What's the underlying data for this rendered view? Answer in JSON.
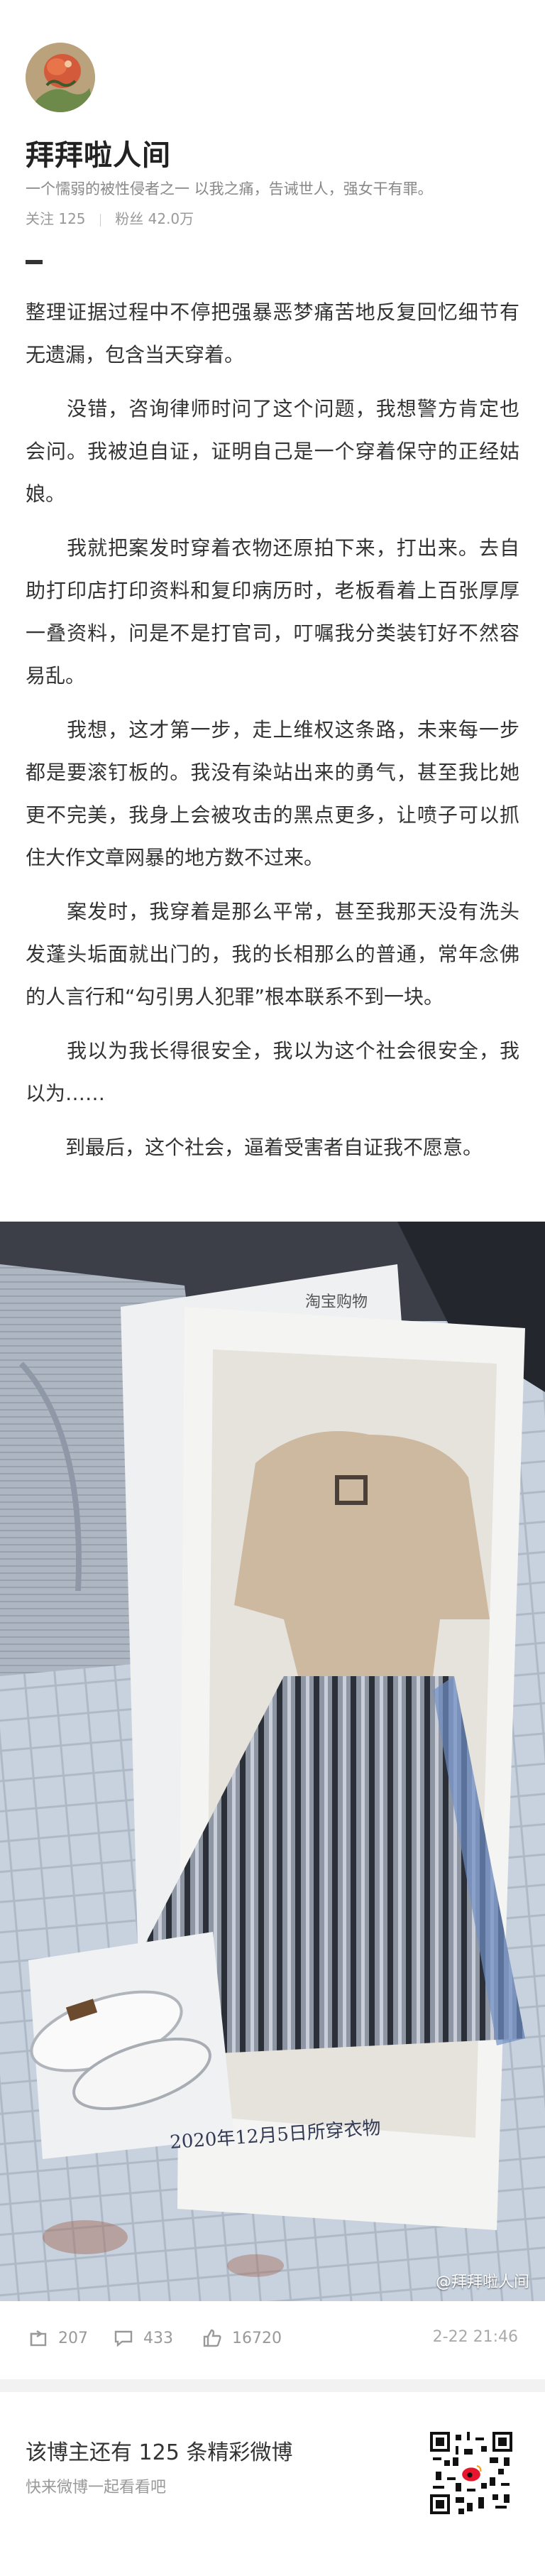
{
  "profile": {
    "name": "拜拜啦人间",
    "bio": "一个懦弱的被性侵者之一  以我之痛，告诫世人，强女干有罪。",
    "following_label": "关注",
    "following_count": "125",
    "followers_label": "粉丝",
    "followers_count": "42.0万"
  },
  "article": {
    "paragraphs": [
      "整理证据过程中不停把强暴恶梦痛苦地反复回忆细节有无遗漏，包含当天穿着。",
      "　　没错，咨询律师时问了这个问题，我想警方肯定也会问。我被迫自证，证明自己是一个穿着保守的正经姑娘。",
      "　　我就把案发时穿着衣物还原拍下来，打出来。去自助打印店打印资料和复印病历时，老板看着上百张厚厚一叠资料，问是不是打官司，叮嘱我分类装钉好不然容易乱。",
      "　　我想，这才第一步，走上维权这条路，未来每一步都是要滚钉板的。我没有染站出来的勇气，甚至我比她更不完美，我身上会被攻击的黑点更多，让喷子可以抓住大作文章网暴的地方数不过来。",
      "　　案发时，我穿着是那么平常，甚至我那天没有洗头发蓬头垢面就出门的，我的长相那么的普通，常年念佛的人言行和“勾引男人犯罪”根本联系不到一块。",
      "　　我以为我长得很安全，我以为这个社会很安全，我以为……",
      "　　到最后，这个社会，逼着受害者自证我不愿意。"
    ]
  },
  "photo": {
    "handwritten_note": "2020年12月5日所穿衣物",
    "watermark": "@拜拜啦人间",
    "print_header": "淘宝购物"
  },
  "actions": {
    "repost_count": "207",
    "comment_count": "433",
    "like_count": "16720",
    "date": "2-22 21:46"
  },
  "footer": {
    "title": "该博主还有 125 条精彩微博",
    "subtitle": "快来微博一起看看吧"
  },
  "colors": {
    "text": "#333333",
    "muted": "#999999",
    "divider": "#f2f2f2"
  },
  "icons": {
    "repost": "repost-icon",
    "comment": "comment-icon",
    "like": "like-icon",
    "weibo": "weibo-logo-icon"
  }
}
